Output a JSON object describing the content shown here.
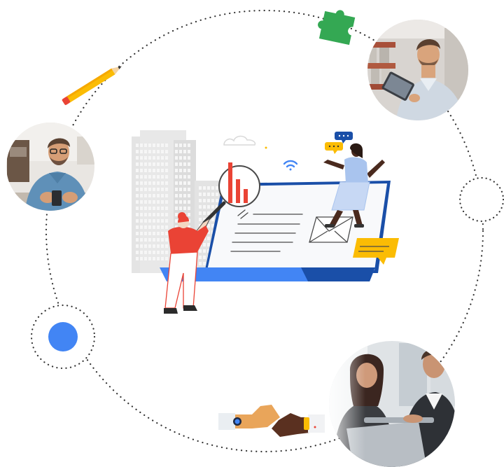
{
  "colors": {
    "blue": "#4285f4",
    "dark_blue": "#1a4fa8",
    "red": "#ea4335",
    "yellow": "#fbbc04",
    "green": "#34a853",
    "dotted_ring": "#333333",
    "building": "#e2e2e2",
    "skin_light": "#e8a860",
    "skin_dark": "#4b2a1a"
  },
  "icons": {
    "ring": "dotted-orbit-ring",
    "puzzle": "puzzle-piece-icon",
    "pencil": "pencil-icon",
    "dot": "blue-dot-icon",
    "wifi": "wifi-icon",
    "cloud": "cloud-icon",
    "envelope": "envelope-icon",
    "chat": "chat-bubble-icon",
    "handshake": "handshake-icon",
    "magnifier": "magnifying-glass-icon"
  },
  "photos": [
    {
      "id": "man-with-tablet-warehouse"
    },
    {
      "id": "man-with-phone-smiling"
    },
    {
      "id": "two-colleagues-at-laptop"
    }
  ]
}
